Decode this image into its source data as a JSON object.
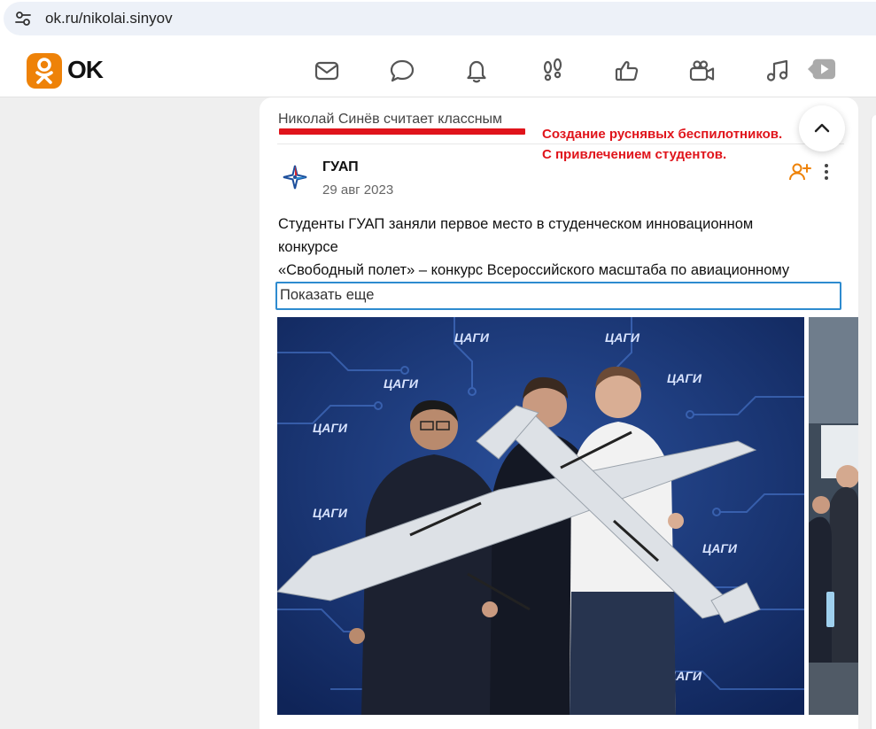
{
  "browser": {
    "url": "ok.ru/nikolai.sinyov"
  },
  "header": {
    "brand": "OK",
    "nav_icons": [
      "mail-icon",
      "chat-icon",
      "bell-icon",
      "footprints-icon",
      "like-icon",
      "video-icon",
      "music-icon",
      "play-icon"
    ],
    "accent_color": "#ee8208"
  },
  "post": {
    "liked_by": "Николай Синёв считает классным",
    "annotation_line1": "Создание руснявых беспилотников.",
    "annotation_line2": "С привлечением студентов.",
    "annotation_color": "#e0141b",
    "group_name": "ГУАП",
    "date": "29 авг 2023",
    "text_line1": "Студенты ГУАП заняли первое место в студенческом инновационном",
    "text_line2": "конкурсе",
    "text_line3": "«Свободный полет» – конкурс Всероссийского масштаба по авиационному",
    "show_more": "Показать еще",
    "photo_backdrop_label": "ЦАГИ"
  }
}
